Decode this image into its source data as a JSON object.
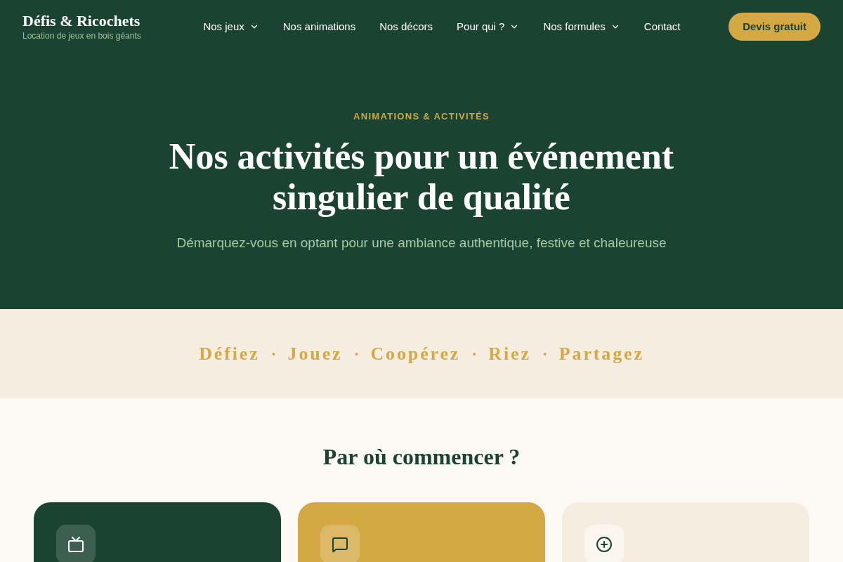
{
  "header": {
    "logo": {
      "title": "Défis & Ricochets",
      "tagline": "Location de jeux en bois géants"
    },
    "nav": [
      {
        "label": "Nos jeux",
        "dropdown": true
      },
      {
        "label": "Nos animations",
        "dropdown": false
      },
      {
        "label": "Nos décors",
        "dropdown": false
      },
      {
        "label": "Pour qui ?",
        "dropdown": true
      },
      {
        "label": "Nos formules",
        "dropdown": true
      },
      {
        "label": "Contact",
        "dropdown": false
      }
    ],
    "cta": "Devis gratuit"
  },
  "hero": {
    "eyebrow": "ANIMATIONS & ACTIVITÉS",
    "title": "Nos activités pour un événement singulier de qualité",
    "subtitle": "Démarquez-vous en optant pour une ambiance authentique, festive et chaleureuse"
  },
  "tagline_band": {
    "words": [
      "Défiez",
      "Jouez",
      "Coopérez",
      "Riez",
      "Partagez"
    ],
    "separator": "·"
  },
  "start_section": {
    "title": "Par où commencer ?",
    "cards": [
      {
        "color": "#1b4332"
      },
      {
        "color": "#d4a843"
      },
      {
        "color": "#f5eee0"
      }
    ]
  }
}
